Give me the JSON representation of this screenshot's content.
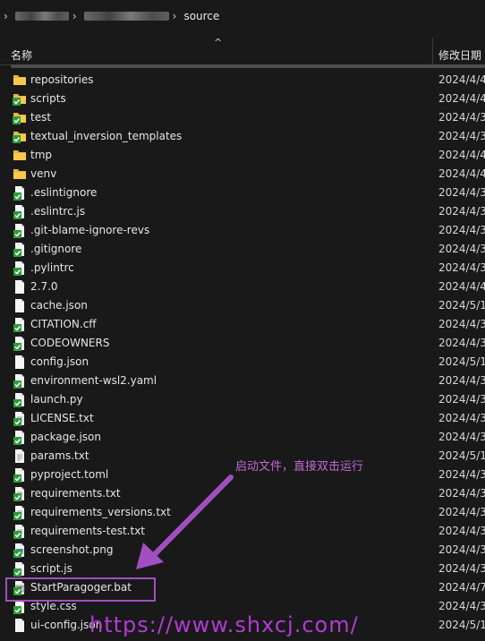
{
  "breadcrumb": {
    "current": "source"
  },
  "header": {
    "name_label": "名称",
    "date_label": "修改日期"
  },
  "files": [
    {
      "name": "repositories",
      "date": "2024/4/4",
      "icon": "folder-icon"
    },
    {
      "name": "scripts",
      "date": "2024/4/4",
      "icon": "folder-icon-git"
    },
    {
      "name": "test",
      "date": "2024/4/3",
      "icon": "folder-icon-git"
    },
    {
      "name": "textual_inversion_templates",
      "date": "2024/4/3",
      "icon": "folder-icon-git"
    },
    {
      "name": "tmp",
      "date": "2024/4/4",
      "icon": "folder-icon"
    },
    {
      "name": "venv",
      "date": "2024/4/4",
      "icon": "folder-icon"
    },
    {
      "name": ".eslintignore",
      "date": "2024/4/3",
      "icon": "file-git-icon"
    },
    {
      "name": ".eslintrc.js",
      "date": "2024/4/3",
      "icon": "file-git-icon"
    },
    {
      "name": ".git-blame-ignore-revs",
      "date": "2024/4/3",
      "icon": "file-git-icon"
    },
    {
      "name": ".gitignore",
      "date": "2024/4/3",
      "icon": "file-git-icon"
    },
    {
      "name": ".pylintrc",
      "date": "2024/4/3",
      "icon": "file-git-icon"
    },
    {
      "name": "2.7.0",
      "date": "2024/4/4",
      "icon": "file-icon"
    },
    {
      "name": "cache.json",
      "date": "2024/5/1",
      "icon": "file-icon"
    },
    {
      "name": "CITATION.cff",
      "date": "2024/4/3",
      "icon": "file-git-icon"
    },
    {
      "name": "CODEOWNERS",
      "date": "2024/4/3",
      "icon": "file-git-icon"
    },
    {
      "name": "config.json",
      "date": "2024/5/1",
      "icon": "file-icon"
    },
    {
      "name": "environment-wsl2.yaml",
      "date": "2024/4/3",
      "icon": "file-git-icon"
    },
    {
      "name": "launch.py",
      "date": "2024/4/3",
      "icon": "file-git-icon"
    },
    {
      "name": "LICENSE.txt",
      "date": "2024/4/3",
      "icon": "text-git-icon"
    },
    {
      "name": "package.json",
      "date": "2024/4/3",
      "icon": "file-git-icon"
    },
    {
      "name": "params.txt",
      "date": "2024/5/1",
      "icon": "text-icon"
    },
    {
      "name": "pyproject.toml",
      "date": "2024/4/3",
      "icon": "file-git-icon"
    },
    {
      "name": "requirements.txt",
      "date": "2024/4/3",
      "icon": "text-git-icon"
    },
    {
      "name": "requirements_versions.txt",
      "date": "2024/4/3",
      "icon": "text-git-icon"
    },
    {
      "name": "requirements-test.txt",
      "date": "2024/4/3",
      "icon": "text-git-icon"
    },
    {
      "name": "screenshot.png",
      "date": "2024/4/3",
      "icon": "image-git-icon"
    },
    {
      "name": "script.js",
      "date": "2024/4/3",
      "icon": "file-git-icon"
    },
    {
      "name": "StartParagoger.bat",
      "date": "2024/4/7",
      "icon": "bat-git-icon"
    },
    {
      "name": "style.css",
      "date": "2024/4/3",
      "icon": "file-git-icon"
    },
    {
      "name": "ui-config.json",
      "date": "2024/5/1",
      "icon": "file-icon"
    }
  ],
  "annotation": {
    "note": "启动文件，直接双击运行",
    "color": "#a14fc0"
  },
  "watermark": {
    "text": "https://www.shxcj.com/"
  }
}
